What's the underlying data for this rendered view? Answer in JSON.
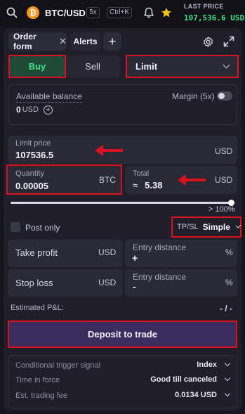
{
  "header": {
    "pair": "BTC/USD",
    "leverage": "5x",
    "shortcut": "Ctrl+K",
    "last_price_label": "LAST PRICE",
    "last_price": "107,536.6 USD"
  },
  "tabs": {
    "order_form": "Order form",
    "alerts": "Alerts",
    "add": "+"
  },
  "side": {
    "buy": "Buy",
    "sell": "Sell",
    "order_type": "Limit"
  },
  "balance": {
    "label": "Available balance",
    "amount": "0",
    "currency": "USD",
    "margin_label": "Margin (5x)"
  },
  "limit_price": {
    "label": "Limit price",
    "value": "107536.5",
    "unit": "USD"
  },
  "quantity": {
    "label": "Quantity",
    "value": "0.00005",
    "unit": "BTC"
  },
  "total": {
    "label": "Total",
    "prefix": "≈",
    "value": "5.38",
    "unit": "USD"
  },
  "slider": {
    "label": "> 100%",
    "fraction": 1.0
  },
  "post_only": {
    "label": "Post only"
  },
  "tpsl": {
    "label": "TP/SL",
    "value": "Simple"
  },
  "take_profit": {
    "label": "Take profit",
    "unit": "USD",
    "distance_label": "Entry distance",
    "distance_sign": "+",
    "distance_unit": "%"
  },
  "stop_loss": {
    "label": "Stop loss",
    "unit": "USD",
    "distance_label": "Entry distance",
    "distance_sign": "-",
    "distance_unit": "%"
  },
  "pnl": {
    "label": "Estimated P&L:",
    "value": "- / -"
  },
  "deposit_button": "Deposit to trade",
  "settings": {
    "trigger_label": "Conditional trigger signal",
    "trigger_value": "Index",
    "tif_label": "Time in force",
    "tif_value": "Good till canceled",
    "fee_label": "Est. trading fee",
    "fee_value": "0.0134 USD"
  },
  "colors": {
    "accent_green": "#3fe08c",
    "buy_bg": "#1f4a35",
    "annotation_red": "#d8121e",
    "deposit_bg": "#3a2d5e",
    "btc_orange": "#f7931a",
    "star_yellow": "#f2c21b"
  }
}
